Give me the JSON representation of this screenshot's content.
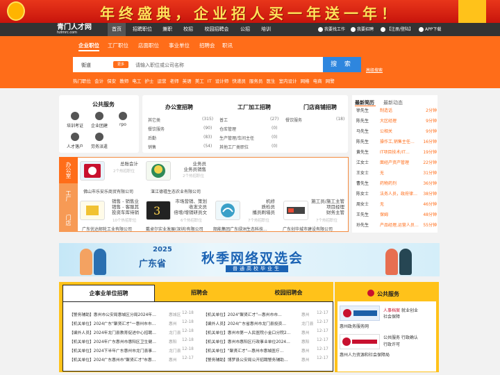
{
  "banner": {
    "text": "年终盛典，企业招人买一年送一年！"
  },
  "nav": {
    "logo": "青门人才网",
    "logo_sub": "hzlmrc.com",
    "items": [
      "首页",
      "招聘职位",
      "兼职",
      "校招",
      "校园招聘会",
      "公招",
      "培训"
    ],
    "right": [
      "我要找工作",
      "我要招聘",
      "【注册/登陆】",
      "APP下载"
    ]
  },
  "search": {
    "tabs": [
      "企业职位",
      "工厂职位",
      "店面职位",
      "事业单位",
      "招聘会",
      "职讯"
    ],
    "city": "街道",
    "badge": "更多",
    "placeholder": "请输入职位或公司名称",
    "button": "搜 索",
    "advanced": "高级搜索",
    "hot": [
      "热门职位",
      "会计",
      "保安",
      "教师",
      "电工",
      "护士",
      "运营",
      "老师",
      "英语",
      "美工",
      "IT",
      "设计师",
      "快递员",
      "服务员",
      "医生",
      "室内设计",
      "网络",
      "电商",
      "网警"
    ]
  },
  "public_service": {
    "title": "公共服务",
    "items": [
      "培训考证",
      "企业团建",
      "rpo",
      "人才落户",
      "劳务派遣"
    ]
  },
  "office": {
    "title": "办公室招聘",
    "rows": [
      [
        "其它类",
        "(315)"
      ],
      [
        "餐饮服务",
        "(90)"
      ],
      [
        "后勤",
        "(83)"
      ],
      [
        "销售",
        "(54)"
      ]
    ]
  },
  "factory": {
    "title": "工厂加工招聘",
    "rows": [
      [
        "普工",
        "(27)"
      ],
      [
        "仓库管理",
        "(0)"
      ],
      [
        "生产管理/车间主任",
        "(0)"
      ],
      [
        "其他工厂类职位",
        "(0)"
      ]
    ]
  },
  "shop": {
    "title": "门店商铺招聘",
    "rows": [
      [
        "餐饮服务",
        "(18)"
      ]
    ]
  },
  "biz_tabs": [
    "办公室",
    "工厂",
    "门店"
  ],
  "companies": [
    {
      "jobs": "总账会计",
      "count": "2个热招职位",
      "name": "佛山市乐安乐商贸有限公司"
    },
    {
      "jobs": "业务员\n业务员销售",
      "count": "2个热招职位",
      "name": "湛江德禧生态农业有限公司"
    },
    {
      "jobs": "销售 - 销售业\n销售 - 客服其\n投资车库待销",
      "count": "10个热招职位",
      "name": "广东优达邮轮工业有限公司"
    },
    {
      "jobs": "市场营销、策划\n收发文员\n倍增/增销研员文",
      "count": "6个热招职位",
      "name": "戴卓尔实业发展(深圳)有限公司"
    },
    {
      "jobs": "机修\n质检员\n播员刷墙员",
      "count": "7个热招职位",
      "name": "韶能集团广东绿洲生态科技..."
    },
    {
      "jobs": "施工员/施工主管\n项目经理\n财务主管",
      "count": "7个热招职位",
      "name": "广东创华城市建设有限公司"
    }
  ],
  "resumes": {
    "tabs": [
      "最新简历",
      "最新动态"
    ],
    "rows": [
      [
        "徐先生",
        "制造话",
        "2分钟"
      ],
      [
        "陈先生",
        "大区经理",
        "9分钟"
      ],
      [
        "马先生",
        "公相关",
        "9分钟"
      ],
      [
        "陈先生",
        "操作工,销售主任…",
        "16分钟"
      ],
      [
        "黄先生",
        "IT项目技术/IT…",
        "19分钟"
      ],
      [
        "江女士",
        "面经产资产管理",
        "22分钟"
      ],
      [
        "王女士",
        "无",
        "31分钟"
      ],
      [
        "曹先生",
        "药物药剂",
        "36分钟"
      ],
      [
        "陈女士",
        "法务人员，政府律…",
        "38分钟"
      ],
      [
        "周女士",
        "无",
        "46分钟"
      ],
      [
        "王先生",
        "保姆",
        "48分钟"
      ],
      [
        "孙先生",
        "产品经理,运营人员…",
        "55分钟"
      ]
    ]
  },
  "fair": {
    "year": "2025",
    "region": "广东省",
    "title": "秋季网络双选会",
    "sub": "普通高校毕业生"
  },
  "recruit_tabs": [
    "企事业单位招聘",
    "招聘会",
    "校园招聘会"
  ],
  "news_left": [
    [
      "【警务辅助】惠州市公安局惠城区分局2024年…",
      "惠城区",
      "12-18"
    ],
    [
      "【机关单位】2024广东\"聚贤汇才\"一惠州市市…",
      "惠州",
      "12-18"
    ],
    [
      "【编外人员】2024年龙门县教育促进中心招聘…",
      "龙门县",
      "12-18"
    ],
    [
      "【机关单位】2024年广东惠州市惠阳区卫生健…",
      "惠阳",
      "12-18"
    ],
    [
      "【机关单位】2024下半年广东惠州市龙门县事…",
      "龙门县",
      "12-18"
    ],
    [
      "【机关单位】2024广东惠州市\"聚贤汇才\"市惠…",
      "惠州",
      "12-17"
    ]
  ],
  "news_right": [
    [
      "【机关单位】2024\"聚贤汇才\"—惠州市市…",
      "惠州",
      "12-17"
    ],
    [
      "【编外人员】2024广东省惠州市龙门县投资…",
      "龙门县",
      "12-17"
    ],
    [
      "【机关单位】惠州市第一人民医院小金口分院2…",
      "惠州",
      "12-17"
    ],
    [
      "【机关单位】惠州市惠阳区行政事业单位2024…",
      "惠阳",
      "12-17"
    ],
    [
      "【机关单位】\"聚贤汇才\"—惠州市惠城医疗…",
      "惠州",
      "12-17"
    ],
    [
      "【警务辅助】博罗县公安局公开招聘警务辅助…",
      "惠州",
      "12-17"
    ]
  ],
  "pub_service": {
    "title": "公共服务",
    "items": [
      {
        "tag": "人事档案",
        "text": "就业创业\n社会保障",
        "caption": "惠州政务服务网"
      },
      {
        "tag": "",
        "text": "公共服务 行政确认\n行政许可",
        "caption": "惠州人力资源和社会保障局"
      }
    ]
  },
  "colors": {
    "accent": "#ff6d19",
    "nav": "#333333",
    "search": "#2e86de",
    "yellow": "#ffc21a",
    "banner": "#d8200f"
  }
}
